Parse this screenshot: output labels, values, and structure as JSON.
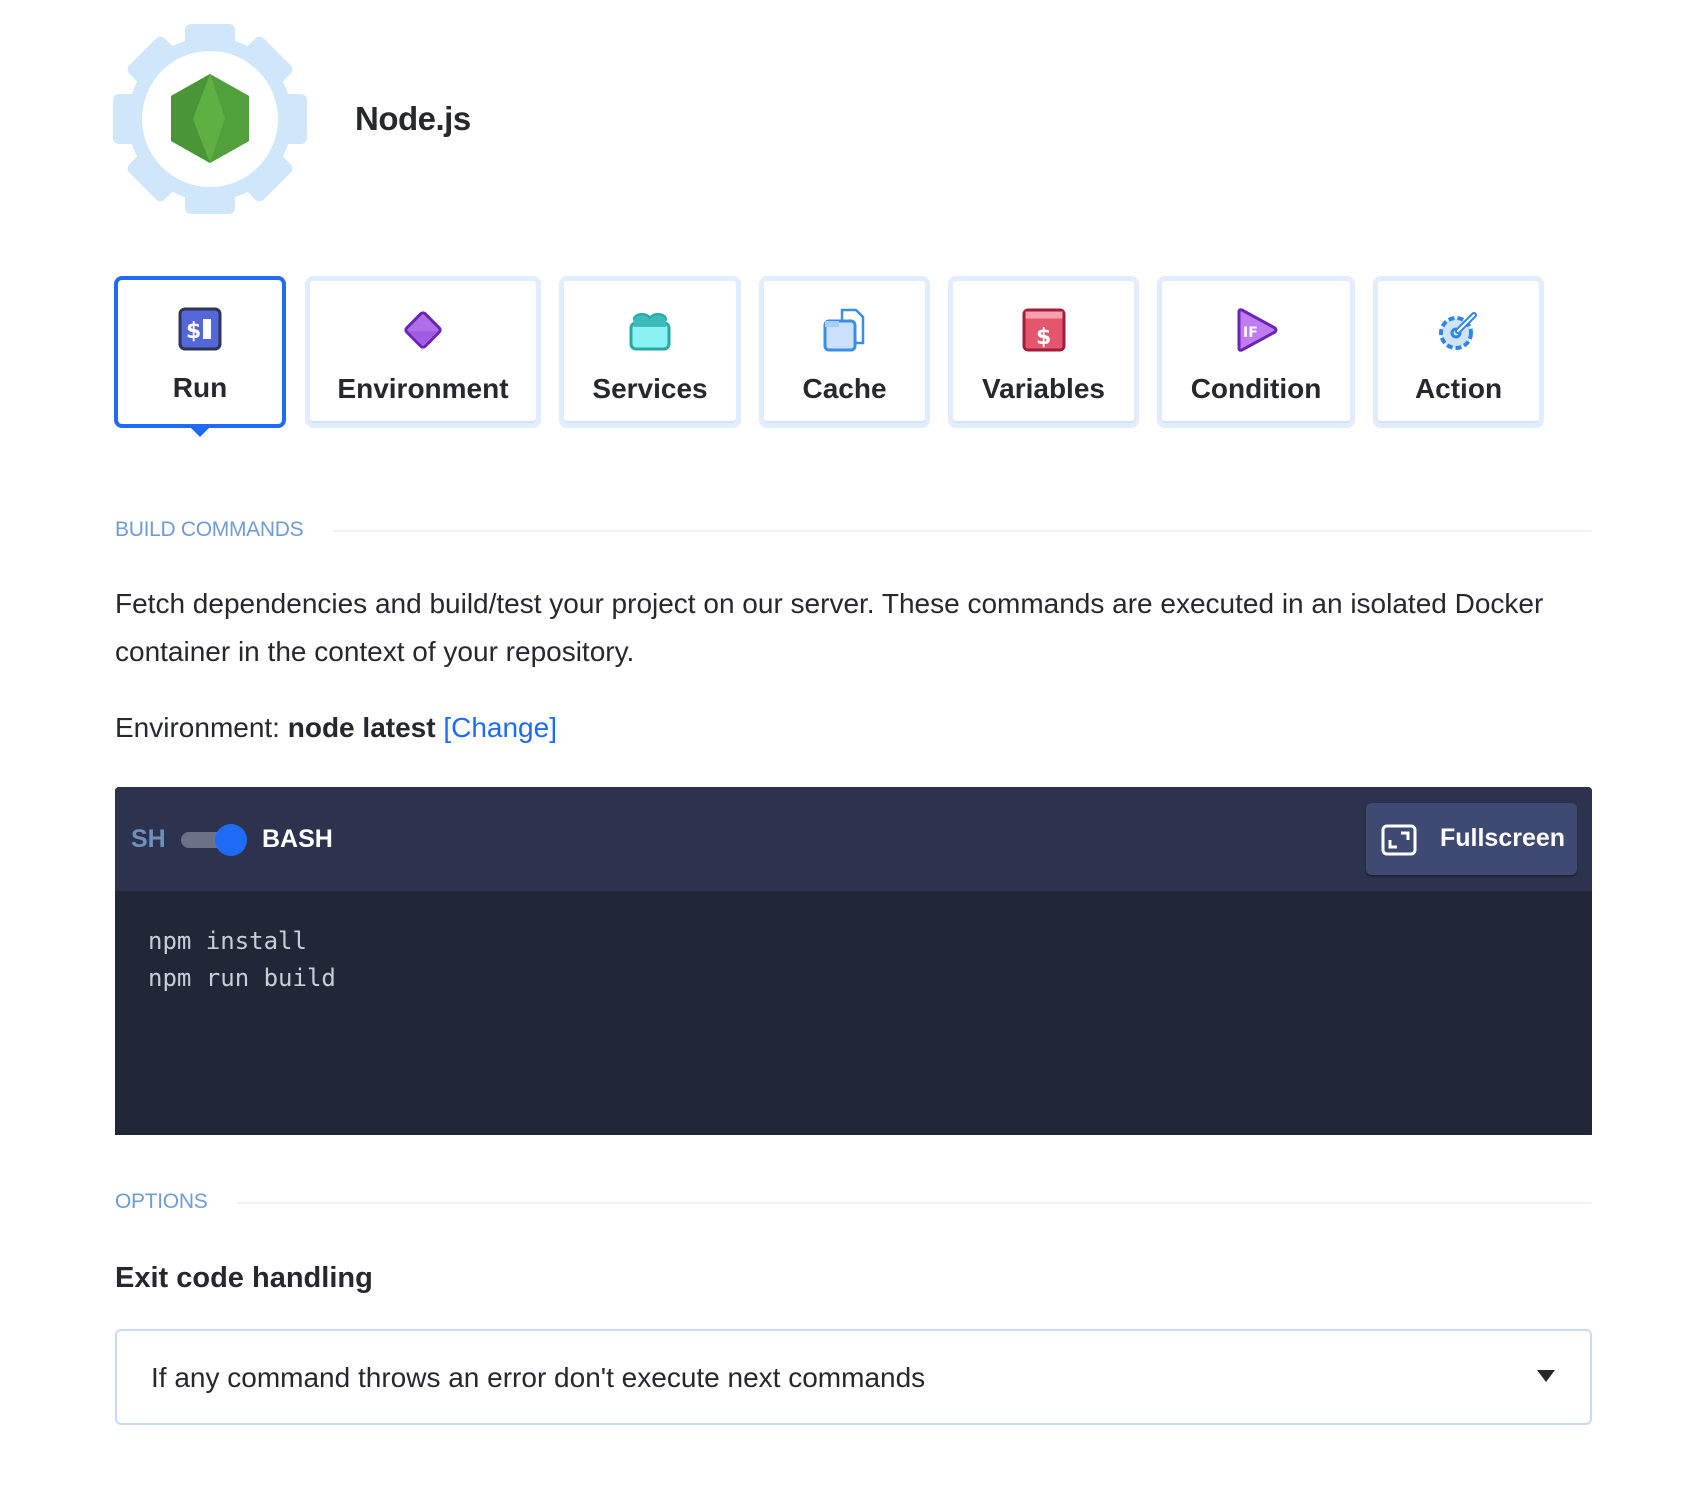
{
  "header": {
    "title": "Node.js",
    "logo_icon": "nodejs-hexagon-in-gear-icon"
  },
  "tabs": [
    {
      "label": "Run",
      "icon": "terminal-dollar-icon",
      "active": true
    },
    {
      "label": "Environment",
      "icon": "purple-diamond-icon",
      "active": false
    },
    {
      "label": "Services",
      "icon": "lego-brick-icon",
      "active": false
    },
    {
      "label": "Cache",
      "icon": "folder-file-icon",
      "active": false
    },
    {
      "label": "Variables",
      "icon": "dollar-window-icon",
      "active": false
    },
    {
      "label": "Condition",
      "icon": "if-play-icon",
      "active": false
    },
    {
      "label": "Action",
      "icon": "wrench-gear-icon",
      "active": false
    }
  ],
  "build_commands": {
    "section_title": "BUILD COMMANDS",
    "description": "Fetch dependencies and build/test your project on our server. These commands are executed in an isolated Docker container in the context of your repository.",
    "environment_prefix": "Environment: ",
    "environment_value": "node latest",
    "change_link": "[Change]"
  },
  "editor": {
    "shell_left": "SH",
    "shell_right": "BASH",
    "shell_toggle_on": true,
    "fullscreen_label": "Fullscreen",
    "code": "npm install\nnpm run build"
  },
  "options": {
    "section_title": "OPTIONS",
    "exit_code_label": "Exit code handling",
    "exit_code_selected": "If any command throws an error don't execute next commands"
  },
  "colors": {
    "accent": "#1f6bf5",
    "section_title": "#6f9cd3",
    "editor_header": "#2d334e",
    "editor_body": "#222738",
    "card_border": "#e1edfc"
  }
}
